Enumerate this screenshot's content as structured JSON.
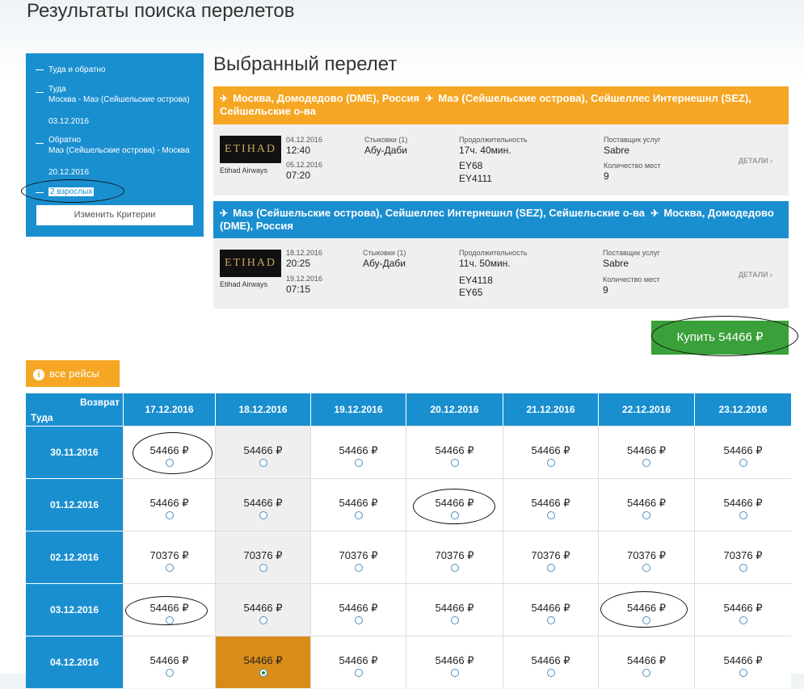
{
  "page_title": "Результаты поиска перелетов",
  "sidebar": {
    "trip_type": "Туда и обратно",
    "outbound": {
      "label": "Туда",
      "route": "Москва - Маэ (Сейшельские острова)",
      "date": "03.12.2016"
    },
    "inbound": {
      "label": "Обратно",
      "route": "Маэ (Сейшельские острова) - Москва",
      "date": "20.12.2016"
    },
    "passengers": "2 взрослых",
    "change_button": "Изменить Критерии"
  },
  "selected": {
    "title": "Выбранный перелет",
    "legs": [
      {
        "from": "Москва, Домодедово (DME), Россия",
        "to": "Маэ (Сейшельские острова), Сейшеллес Интернешнл (SEZ), Сейшельские о-ва",
        "logo": "ETIHAD",
        "airline": "Etihad Airways",
        "dep_date": "04.12.2016",
        "dep_time": "12:40",
        "arr_date": "05.12.2016",
        "arr_time": "07:20",
        "stops_label": "Стыковки (1)",
        "stops": "Абу-Даби",
        "duration_label": "Продолжительность",
        "duration": "17ч. 40мин.",
        "flight1": "EY68",
        "flight2": "EY4111",
        "provider_label": "Поставщик услуг",
        "provider": "Sabre",
        "seats_label": "Количество мест",
        "seats": "9",
        "details": "ДЕТАЛИ ›"
      },
      {
        "from": "Маэ (Сейшельские острова), Сейшеллес Интернешнл (SEZ), Сейшельские о-ва",
        "to": "Москва, Домодедово (DME), Россия",
        "logo": "ETIHAD",
        "airline": "Etihad Airways",
        "dep_date": "18.12.2016",
        "dep_time": "20:25",
        "arr_date": "19.12.2016",
        "arr_time": "07:15",
        "stops_label": "Стыковки (1)",
        "stops": "Абу-Даби",
        "duration_label": "Продолжительность",
        "duration": "11ч. 50мин.",
        "flight1": "EY4118",
        "flight2": "EY65",
        "provider_label": "Поставщик услуг",
        "provider": "Sabre",
        "seats_label": "Количество мест",
        "seats": "9",
        "details": "ДЕТАЛИ ›"
      }
    ],
    "buy_label": "Купить 54466 ₽"
  },
  "all_flights": {
    "icon": "i",
    "label": "все рейсы"
  },
  "grid": {
    "corner_return": "Возврат",
    "corner_outbound": "Туда",
    "columns": [
      "17.12.2016",
      "18.12.2016",
      "19.12.2016",
      "20.12.2016",
      "21.12.2016",
      "22.12.2016",
      "23.12.2016"
    ],
    "rows": [
      {
        "date": "30.11.2016",
        "prices": [
          "54466 ₽",
          "54466 ₽",
          "54466 ₽",
          "54466 ₽",
          "54466 ₽",
          "54466 ₽",
          "54466 ₽"
        ]
      },
      {
        "date": "01.12.2016",
        "prices": [
          "54466 ₽",
          "54466 ₽",
          "54466 ₽",
          "54466 ₽",
          "54466 ₽",
          "54466 ₽",
          "54466 ₽"
        ]
      },
      {
        "date": "02.12.2016",
        "prices": [
          "70376 ₽",
          "70376 ₽",
          "70376 ₽",
          "70376 ₽",
          "70376 ₽",
          "70376 ₽",
          "70376 ₽"
        ]
      },
      {
        "date": "03.12.2016",
        "prices": [
          "54466 ₽",
          "54466 ₽",
          "54466 ₽",
          "54466 ₽",
          "54466 ₽",
          "54466 ₽",
          "54466 ₽"
        ]
      },
      {
        "date": "04.12.2016",
        "prices": [
          "54466 ₽",
          "54466 ₽",
          "54466 ₽",
          "54466 ₽",
          "54466 ₽",
          "54466 ₽",
          "54466 ₽"
        ]
      }
    ],
    "selected_row": 4,
    "selected_col": 1
  }
}
